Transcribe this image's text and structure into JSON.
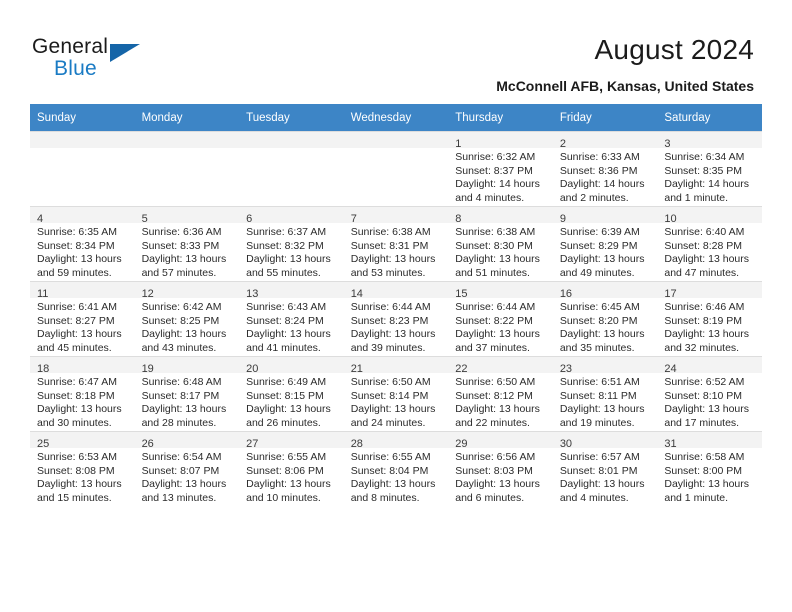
{
  "brand": {
    "name_top": "General",
    "name_bottom": "Blue",
    "accent_color": "#1a7bc4",
    "triangle_color": "#1565a8"
  },
  "header": {
    "title": "August 2024",
    "subtitle": "McConnell AFB, Kansas, United States"
  },
  "calendar": {
    "header_background": "#3d85c6",
    "weekdays": [
      "Sunday",
      "Monday",
      "Tuesday",
      "Wednesday",
      "Thursday",
      "Friday",
      "Saturday"
    ],
    "leading_blanks": 4,
    "days": [
      {
        "day": "1",
        "sunrise": "Sunrise: 6:32 AM",
        "sunset": "Sunset: 8:37 PM",
        "daylight1": "Daylight: 14 hours",
        "daylight2": "and 4 minutes."
      },
      {
        "day": "2",
        "sunrise": "Sunrise: 6:33 AM",
        "sunset": "Sunset: 8:36 PM",
        "daylight1": "Daylight: 14 hours",
        "daylight2": "and 2 minutes."
      },
      {
        "day": "3",
        "sunrise": "Sunrise: 6:34 AM",
        "sunset": "Sunset: 8:35 PM",
        "daylight1": "Daylight: 14 hours",
        "daylight2": "and 1 minute."
      },
      {
        "day": "4",
        "sunrise": "Sunrise: 6:35 AM",
        "sunset": "Sunset: 8:34 PM",
        "daylight1": "Daylight: 13 hours",
        "daylight2": "and 59 minutes."
      },
      {
        "day": "5",
        "sunrise": "Sunrise: 6:36 AM",
        "sunset": "Sunset: 8:33 PM",
        "daylight1": "Daylight: 13 hours",
        "daylight2": "and 57 minutes."
      },
      {
        "day": "6",
        "sunrise": "Sunrise: 6:37 AM",
        "sunset": "Sunset: 8:32 PM",
        "daylight1": "Daylight: 13 hours",
        "daylight2": "and 55 minutes."
      },
      {
        "day": "7",
        "sunrise": "Sunrise: 6:38 AM",
        "sunset": "Sunset: 8:31 PM",
        "daylight1": "Daylight: 13 hours",
        "daylight2": "and 53 minutes."
      },
      {
        "day": "8",
        "sunrise": "Sunrise: 6:38 AM",
        "sunset": "Sunset: 8:30 PM",
        "daylight1": "Daylight: 13 hours",
        "daylight2": "and 51 minutes."
      },
      {
        "day": "9",
        "sunrise": "Sunrise: 6:39 AM",
        "sunset": "Sunset: 8:29 PM",
        "daylight1": "Daylight: 13 hours",
        "daylight2": "and 49 minutes."
      },
      {
        "day": "10",
        "sunrise": "Sunrise: 6:40 AM",
        "sunset": "Sunset: 8:28 PM",
        "daylight1": "Daylight: 13 hours",
        "daylight2": "and 47 minutes."
      },
      {
        "day": "11",
        "sunrise": "Sunrise: 6:41 AM",
        "sunset": "Sunset: 8:27 PM",
        "daylight1": "Daylight: 13 hours",
        "daylight2": "and 45 minutes."
      },
      {
        "day": "12",
        "sunrise": "Sunrise: 6:42 AM",
        "sunset": "Sunset: 8:25 PM",
        "daylight1": "Daylight: 13 hours",
        "daylight2": "and 43 minutes."
      },
      {
        "day": "13",
        "sunrise": "Sunrise: 6:43 AM",
        "sunset": "Sunset: 8:24 PM",
        "daylight1": "Daylight: 13 hours",
        "daylight2": "and 41 minutes."
      },
      {
        "day": "14",
        "sunrise": "Sunrise: 6:44 AM",
        "sunset": "Sunset: 8:23 PM",
        "daylight1": "Daylight: 13 hours",
        "daylight2": "and 39 minutes."
      },
      {
        "day": "15",
        "sunrise": "Sunrise: 6:44 AM",
        "sunset": "Sunset: 8:22 PM",
        "daylight1": "Daylight: 13 hours",
        "daylight2": "and 37 minutes."
      },
      {
        "day": "16",
        "sunrise": "Sunrise: 6:45 AM",
        "sunset": "Sunset: 8:20 PM",
        "daylight1": "Daylight: 13 hours",
        "daylight2": "and 35 minutes."
      },
      {
        "day": "17",
        "sunrise": "Sunrise: 6:46 AM",
        "sunset": "Sunset: 8:19 PM",
        "daylight1": "Daylight: 13 hours",
        "daylight2": "and 32 minutes."
      },
      {
        "day": "18",
        "sunrise": "Sunrise: 6:47 AM",
        "sunset": "Sunset: 8:18 PM",
        "daylight1": "Daylight: 13 hours",
        "daylight2": "and 30 minutes."
      },
      {
        "day": "19",
        "sunrise": "Sunrise: 6:48 AM",
        "sunset": "Sunset: 8:17 PM",
        "daylight1": "Daylight: 13 hours",
        "daylight2": "and 28 minutes."
      },
      {
        "day": "20",
        "sunrise": "Sunrise: 6:49 AM",
        "sunset": "Sunset: 8:15 PM",
        "daylight1": "Daylight: 13 hours",
        "daylight2": "and 26 minutes."
      },
      {
        "day": "21",
        "sunrise": "Sunrise: 6:50 AM",
        "sunset": "Sunset: 8:14 PM",
        "daylight1": "Daylight: 13 hours",
        "daylight2": "and 24 minutes."
      },
      {
        "day": "22",
        "sunrise": "Sunrise: 6:50 AM",
        "sunset": "Sunset: 8:12 PM",
        "daylight1": "Daylight: 13 hours",
        "daylight2": "and 22 minutes."
      },
      {
        "day": "23",
        "sunrise": "Sunrise: 6:51 AM",
        "sunset": "Sunset: 8:11 PM",
        "daylight1": "Daylight: 13 hours",
        "daylight2": "and 19 minutes."
      },
      {
        "day": "24",
        "sunrise": "Sunrise: 6:52 AM",
        "sunset": "Sunset: 8:10 PM",
        "daylight1": "Daylight: 13 hours",
        "daylight2": "and 17 minutes."
      },
      {
        "day": "25",
        "sunrise": "Sunrise: 6:53 AM",
        "sunset": "Sunset: 8:08 PM",
        "daylight1": "Daylight: 13 hours",
        "daylight2": "and 15 minutes."
      },
      {
        "day": "26",
        "sunrise": "Sunrise: 6:54 AM",
        "sunset": "Sunset: 8:07 PM",
        "daylight1": "Daylight: 13 hours",
        "daylight2": "and 13 minutes."
      },
      {
        "day": "27",
        "sunrise": "Sunrise: 6:55 AM",
        "sunset": "Sunset: 8:06 PM",
        "daylight1": "Daylight: 13 hours",
        "daylight2": "and 10 minutes."
      },
      {
        "day": "28",
        "sunrise": "Sunrise: 6:55 AM",
        "sunset": "Sunset: 8:04 PM",
        "daylight1": "Daylight: 13 hours",
        "daylight2": "and 8 minutes."
      },
      {
        "day": "29",
        "sunrise": "Sunrise: 6:56 AM",
        "sunset": "Sunset: 8:03 PM",
        "daylight1": "Daylight: 13 hours",
        "daylight2": "and 6 minutes."
      },
      {
        "day": "30",
        "sunrise": "Sunrise: 6:57 AM",
        "sunset": "Sunset: 8:01 PM",
        "daylight1": "Daylight: 13 hours",
        "daylight2": "and 4 minutes."
      },
      {
        "day": "31",
        "sunrise": "Sunrise: 6:58 AM",
        "sunset": "Sunset: 8:00 PM",
        "daylight1": "Daylight: 13 hours",
        "daylight2": "and 1 minute."
      }
    ]
  }
}
